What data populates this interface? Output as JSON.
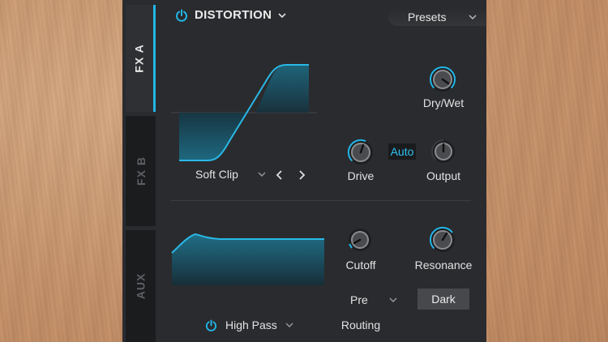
{
  "tabs": [
    {
      "label": "FX A",
      "active": true
    },
    {
      "label": "FX B",
      "active": false
    },
    {
      "label": "AUX",
      "active": false
    }
  ],
  "header": {
    "effect_name": "DISTORTION",
    "presets_label": "Presets"
  },
  "distortion": {
    "curve_type": "Soft Clip",
    "auto_label": "Auto",
    "knobs": {
      "dry_wet": "Dry/Wet",
      "drive": "Drive",
      "output": "Output"
    }
  },
  "filter": {
    "type": "High Pass",
    "knobs": {
      "cutoff": "Cutoff",
      "resonance": "Resonance"
    },
    "routing_value": "Pre",
    "routing_label": "Routing",
    "dark_label": "Dark"
  },
  "colors": {
    "accent": "#21b6e8",
    "panel": "#2a2b2e"
  }
}
